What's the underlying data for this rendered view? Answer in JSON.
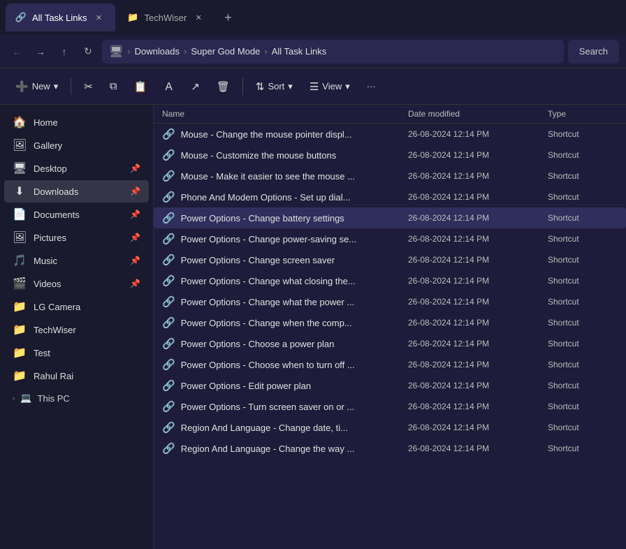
{
  "titleBar": {
    "tabs": [
      {
        "id": "all-task-links",
        "label": "All Task Links",
        "active": true,
        "icon": "🔗"
      },
      {
        "id": "techwiser",
        "label": "TechWiser",
        "active": false,
        "icon": "📁"
      }
    ],
    "newTabLabel": "+"
  },
  "addressBar": {
    "back": "←",
    "forward": "→",
    "up": "↑",
    "refresh": "↻",
    "breadcrumbs": [
      "Downloads",
      "Super God Mode",
      "All Task Links"
    ],
    "searchLabel": "Search"
  },
  "toolbar": {
    "newLabel": "New",
    "newDropIcon": "▾",
    "cutIcon": "✂",
    "copyIcon": "⧉",
    "pasteIcon": "📋",
    "renameIcon": "Ａ",
    "shareIcon": "↗",
    "deleteIcon": "🗑",
    "sortLabel": "Sort",
    "sortDropIcon": "▾",
    "viewLabel": "View",
    "viewDropIcon": "▾",
    "moreIcon": "···"
  },
  "sidebar": {
    "items": [
      {
        "id": "home",
        "label": "Home",
        "icon": "🏠",
        "pinnable": false
      },
      {
        "id": "gallery",
        "label": "Gallery",
        "icon": "🖼",
        "pinnable": false
      },
      {
        "id": "desktop",
        "label": "Desktop",
        "icon": "🖥",
        "pinnable": true
      },
      {
        "id": "downloads",
        "label": "Downloads",
        "icon": "⬇",
        "pinnable": true,
        "active": true
      },
      {
        "id": "documents",
        "label": "Documents",
        "icon": "📄",
        "pinnable": true
      },
      {
        "id": "pictures",
        "label": "Pictures",
        "icon": "🖼",
        "pinnable": true
      },
      {
        "id": "music",
        "label": "Music",
        "icon": "🎵",
        "pinnable": true
      },
      {
        "id": "videos",
        "label": "Videos",
        "icon": "🎬",
        "pinnable": true
      },
      {
        "id": "lg-camera",
        "label": "LG Camera",
        "icon": "📁",
        "pinnable": false
      },
      {
        "id": "techwiser",
        "label": "TechWiser",
        "icon": "📁",
        "pinnable": false
      },
      {
        "id": "test",
        "label": "Test",
        "icon": "📁",
        "pinnable": false
      },
      {
        "id": "rahul-rai",
        "label": "Rahul Rai",
        "icon": "📁",
        "pinnable": false
      }
    ],
    "thisPC": {
      "label": "This PC",
      "icon": "💻",
      "chevron": ">"
    }
  },
  "fileList": {
    "columns": [
      "Name",
      "Date modified",
      "Type"
    ],
    "files": [
      {
        "name": "Mouse - Change the mouse pointer displ...",
        "date": "26-08-2024 12:14 PM",
        "type": "Shortcut",
        "selected": false
      },
      {
        "name": "Mouse - Customize the mouse buttons",
        "date": "26-08-2024 12:14 PM",
        "type": "Shortcut",
        "selected": false
      },
      {
        "name": "Mouse - Make it easier to see the mouse ...",
        "date": "26-08-2024 12:14 PM",
        "type": "Shortcut",
        "selected": false
      },
      {
        "name": "Phone And Modem Options - Set up dial...",
        "date": "26-08-2024 12:14 PM",
        "type": "Shortcut",
        "selected": false
      },
      {
        "name": "Power Options - Change battery settings",
        "date": "26-08-2024 12:14 PM",
        "type": "Shortcut",
        "selected": true
      },
      {
        "name": "Power Options - Change power-saving se...",
        "date": "26-08-2024 12:14 PM",
        "type": "Shortcut",
        "selected": false
      },
      {
        "name": "Power Options - Change screen saver",
        "date": "26-08-2024 12:14 PM",
        "type": "Shortcut",
        "selected": false
      },
      {
        "name": "Power Options - Change what closing the...",
        "date": "26-08-2024 12:14 PM",
        "type": "Shortcut",
        "selected": false
      },
      {
        "name": "Power Options - Change what the power ...",
        "date": "26-08-2024 12:14 PM",
        "type": "Shortcut",
        "selected": false
      },
      {
        "name": "Power Options - Change when the comp...",
        "date": "26-08-2024 12:14 PM",
        "type": "Shortcut",
        "selected": false
      },
      {
        "name": "Power Options - Choose a power plan",
        "date": "26-08-2024 12:14 PM",
        "type": "Shortcut",
        "selected": false
      },
      {
        "name": "Power Options - Choose when to turn off ...",
        "date": "26-08-2024 12:14 PM",
        "type": "Shortcut",
        "selected": false
      },
      {
        "name": "Power Options - Edit power plan",
        "date": "26-08-2024 12:14 PM",
        "type": "Shortcut",
        "selected": false
      },
      {
        "name": "Power Options - Turn screen saver on or ...",
        "date": "26-08-2024 12:14 PM",
        "type": "Shortcut",
        "selected": false
      },
      {
        "name": "Region And Language - Change date, ti...",
        "date": "26-08-2024 12:14 PM",
        "type": "Shortcut",
        "selected": false
      },
      {
        "name": "Region And Language - Change the way ...",
        "date": "26-08-2024 12:14 PM",
        "type": "Shortcut",
        "selected": false
      }
    ]
  }
}
